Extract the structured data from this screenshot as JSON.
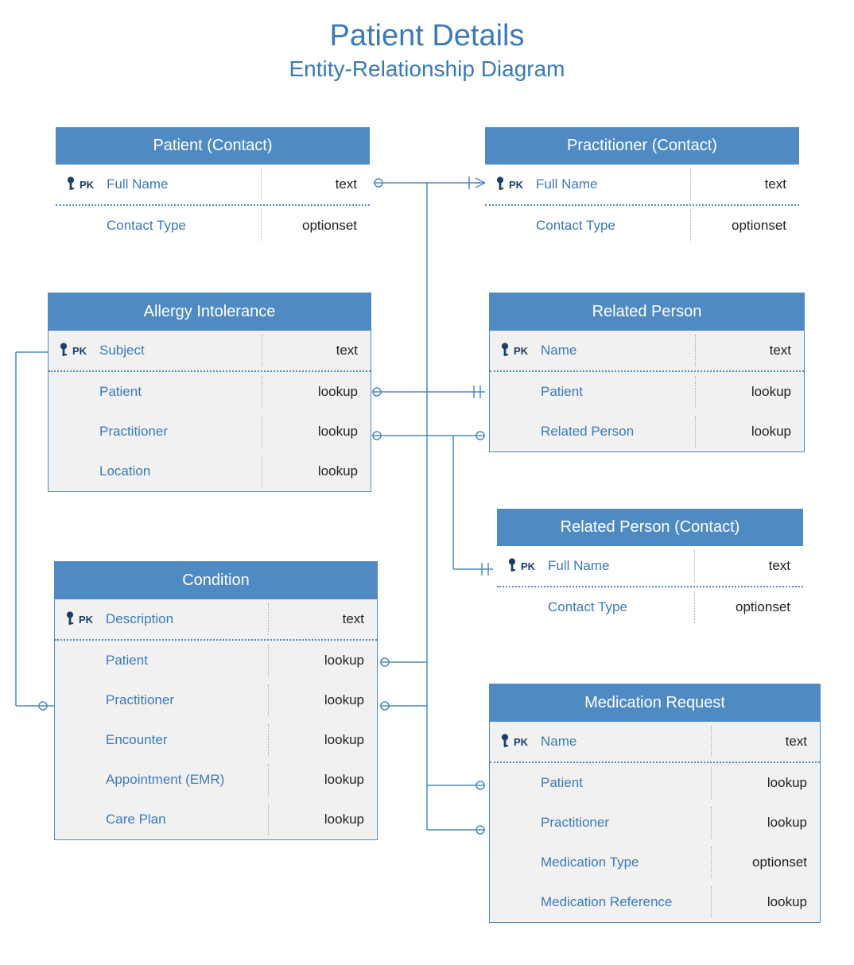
{
  "title": "Patient Details",
  "subtitle": "Entity-Relationship Diagram",
  "entities": {
    "patient": {
      "header": "Patient (Contact)",
      "rows": [
        {
          "pk": true,
          "name": "Full Name",
          "type": "text"
        },
        {
          "pk": false,
          "name": "Contact Type",
          "type": "optionset"
        }
      ]
    },
    "practitioner": {
      "header": "Practitioner (Contact)",
      "rows": [
        {
          "pk": true,
          "name": "Full Name",
          "type": "text"
        },
        {
          "pk": false,
          "name": "Contact Type",
          "type": "optionset"
        }
      ]
    },
    "allergy": {
      "header": "Allergy Intolerance",
      "rows": [
        {
          "pk": true,
          "name": "Subject",
          "type": "text"
        },
        {
          "pk": false,
          "name": "Patient",
          "type": "lookup"
        },
        {
          "pk": false,
          "name": "Practitioner",
          "type": "lookup"
        },
        {
          "pk": false,
          "name": "Location",
          "type": "lookup"
        }
      ]
    },
    "relatedPerson": {
      "header": "Related Person",
      "rows": [
        {
          "pk": true,
          "name": "Name",
          "type": "text"
        },
        {
          "pk": false,
          "name": "Patient",
          "type": "lookup"
        },
        {
          "pk": false,
          "name": "Related Person",
          "type": "lookup"
        }
      ]
    },
    "relatedPersonContact": {
      "header": "Related Person (Contact)",
      "rows": [
        {
          "pk": true,
          "name": "Full Name",
          "type": "text"
        },
        {
          "pk": false,
          "name": "Contact Type",
          "type": "optionset"
        }
      ]
    },
    "condition": {
      "header": "Condition",
      "rows": [
        {
          "pk": true,
          "name": "Description",
          "type": "text"
        },
        {
          "pk": false,
          "name": "Patient",
          "type": "lookup"
        },
        {
          "pk": false,
          "name": "Practitioner",
          "type": "lookup"
        },
        {
          "pk": false,
          "name": "Encounter",
          "type": "lookup"
        },
        {
          "pk": false,
          "name": "Appointment (EMR)",
          "type": "lookup"
        },
        {
          "pk": false,
          "name": "Care Plan",
          "type": "lookup"
        }
      ]
    },
    "medication": {
      "header": "Medication Request",
      "rows": [
        {
          "pk": true,
          "name": "Name",
          "type": "text"
        },
        {
          "pk": false,
          "name": "Patient",
          "type": "lookup"
        },
        {
          "pk": false,
          "name": "Practitioner",
          "type": "lookup"
        },
        {
          "pk": false,
          "name": "Medication Type",
          "type": "optionset"
        },
        {
          "pk": false,
          "name": "Medication Reference",
          "type": "lookup"
        }
      ]
    }
  },
  "pk_label": "PK"
}
